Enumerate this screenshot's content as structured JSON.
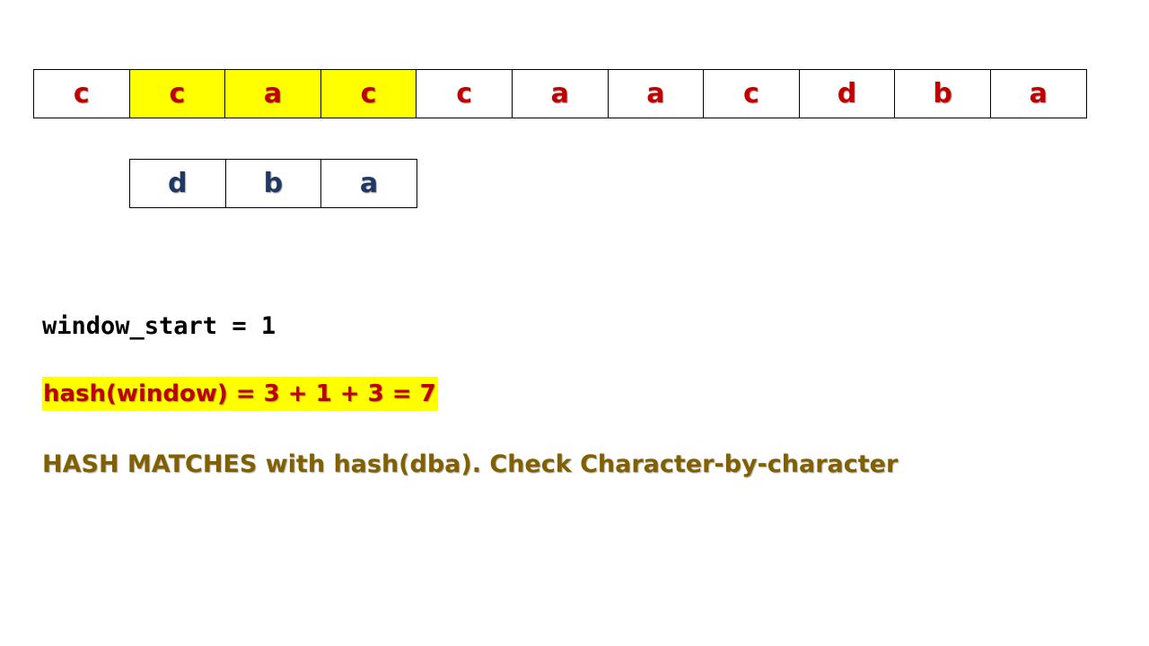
{
  "text_cells": [
    {
      "char": "c",
      "highlighted": false
    },
    {
      "char": "c",
      "highlighted": true
    },
    {
      "char": "a",
      "highlighted": true
    },
    {
      "char": "c",
      "highlighted": true
    },
    {
      "char": "c",
      "highlighted": false
    },
    {
      "char": "a",
      "highlighted": false
    },
    {
      "char": "a",
      "highlighted": false
    },
    {
      "char": "c",
      "highlighted": false
    },
    {
      "char": "d",
      "highlighted": false
    },
    {
      "char": "b",
      "highlighted": false
    },
    {
      "char": "a",
      "highlighted": false
    }
  ],
  "pattern_cells": [
    "d",
    "b",
    "a"
  ],
  "window_start_label": "window_start = 1",
  "hash_window_label": "hash(window) = 3 + 1 + 3 = 7",
  "match_message": "HASH MATCHES with hash(dba). Check Character-by-character",
  "colors": {
    "text_char": "#c00000",
    "pattern_char": "#1f3864",
    "highlight": "#ffff00",
    "match_message": "#806000"
  }
}
